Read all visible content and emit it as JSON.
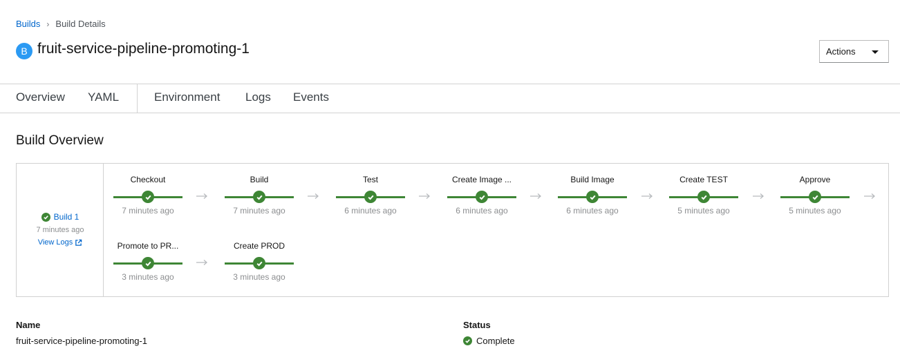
{
  "breadcrumb": {
    "parent": "Builds",
    "current": "Build Details"
  },
  "header": {
    "badge": "B",
    "title": "fruit-service-pipeline-promoting-1",
    "actions_label": "Actions"
  },
  "tabs": [
    {
      "label": "Overview"
    },
    {
      "label": "YAML"
    },
    {
      "label": "Environment"
    },
    {
      "label": "Logs"
    },
    {
      "label": "Events"
    }
  ],
  "section_title": "Build Overview",
  "build": {
    "name": "Build 1",
    "time": "7 minutes ago",
    "logs_label": "View Logs"
  },
  "stages": [
    {
      "name": "Checkout",
      "time": "7 minutes ago",
      "status": "complete"
    },
    {
      "name": "Build",
      "time": "7 minutes ago",
      "status": "complete"
    },
    {
      "name": "Test",
      "time": "6 minutes ago",
      "status": "complete"
    },
    {
      "name": "Create Image ...",
      "time": "6 minutes ago",
      "status": "complete"
    },
    {
      "name": "Build Image",
      "time": "6 minutes ago",
      "status": "complete"
    },
    {
      "name": "Create TEST",
      "time": "5 minutes ago",
      "status": "complete"
    },
    {
      "name": "Approve",
      "time": "5 minutes ago",
      "status": "complete"
    },
    {
      "name": "Promote to PR...",
      "time": "3 minutes ago",
      "status": "complete"
    },
    {
      "name": "Create PROD",
      "time": "3 minutes ago",
      "status": "complete"
    }
  ],
  "details": {
    "name_label": "Name",
    "name_value": "fruit-service-pipeline-promoting-1",
    "status_label": "Status",
    "status_value": "Complete"
  },
  "colors": {
    "link": "#0066cc",
    "success": "#3e8635",
    "badge": "#2b9af3"
  },
  "icons": {
    "success": "check-circle-icon",
    "external": "external-link-icon",
    "arrow": "arrow-right-icon",
    "caret": "caret-down-icon"
  }
}
